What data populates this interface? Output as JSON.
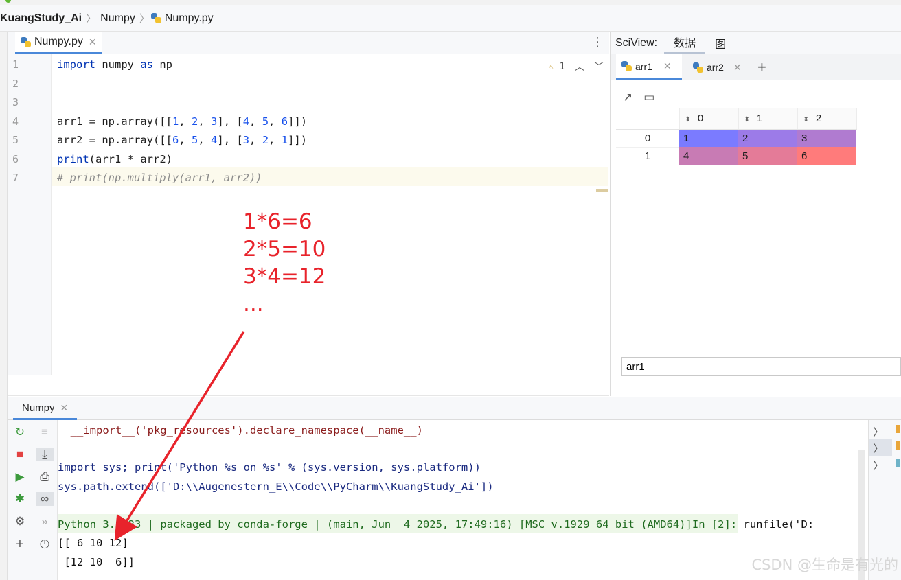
{
  "breadcrumb": {
    "project": "KuangStudy_Ai",
    "folder": "Numpy",
    "file": "Numpy.py"
  },
  "editor": {
    "tab_label": "Numpy.py",
    "warning_count": "1",
    "line_numbers": [
      "1",
      "2",
      "3",
      "4",
      "5",
      "6",
      "7"
    ],
    "lines": {
      "l1": {
        "kw1": "import",
        "t1": " numpy ",
        "kw2": "as",
        "t2": " np"
      },
      "l4": {
        "a": "arr1 = np.array([[",
        "n1": "1",
        "c1": ", ",
        "n2": "2",
        "c2": ", ",
        "n3": "3",
        "b": "], [",
        "n4": "4",
        "c3": ", ",
        "n5": "5",
        "c4": ", ",
        "n6": "6",
        "e": "]])"
      },
      "l5": {
        "a": "arr2 = np.array([[",
        "n1": "6",
        "c1": ", ",
        "n2": "5",
        "c2": ", ",
        "n3": "4",
        "b": "], [",
        "n4": "3",
        "c3": ", ",
        "n5": "2",
        "c4": ", ",
        "n6": "1",
        "e": "]])"
      },
      "l6": {
        "fn": "print",
        "rest": "(arr1 * arr2)"
      },
      "l7": "# print(np.multiply(arr1, arr2))"
    }
  },
  "annotation": [
    "1*6=6",
    "2*5=10",
    "3*4=12",
    "..."
  ],
  "sciview": {
    "title": "SciView:",
    "tabs": [
      "数据",
      "图"
    ],
    "var_tabs": [
      "arr1",
      "arr2"
    ],
    "columns": [
      "0",
      "1",
      "2"
    ],
    "rows": [
      {
        "index": "0",
        "cells": [
          "1",
          "2",
          "3"
        ]
      },
      {
        "index": "1",
        "cells": [
          "4",
          "5",
          "6"
        ]
      }
    ],
    "cell_colors": [
      "#7b7bff",
      "#9c7be8",
      "#b07bd0",
      "#c87bb4",
      "#e47b98",
      "#ff7b7b"
    ],
    "input_value": "arr1"
  },
  "run": {
    "tab_label": "Numpy",
    "console": {
      "line1": "  __import__('pkg_resources').declare_namespace(__name__)",
      "line2": "import sys; print('Python %s on %s' % (sys.version, sys.platform))",
      "line3": "sys.path.extend(['D:\\\\Augenestern_E\\\\Code\\\\PyCharm\\\\KuangStudy_Ai'])",
      "banner": "Python 3.9.23 | packaged by conda-forge | (main, Jun  4 2025, 17:49:16) [MSC v.1929 64 bit (AMD64)]",
      "prompt": "In [2]:",
      "runfile": " runfile('D:",
      "out1": "[[ 6 10 12]",
      "out2": " [12 10  6]]"
    }
  },
  "watermark": "CSDN @生命是有光的",
  "colors": {
    "accent": "#4a88d9",
    "annotation": "#e8232b",
    "keyword": "#0033b3",
    "number": "#1750eb"
  }
}
